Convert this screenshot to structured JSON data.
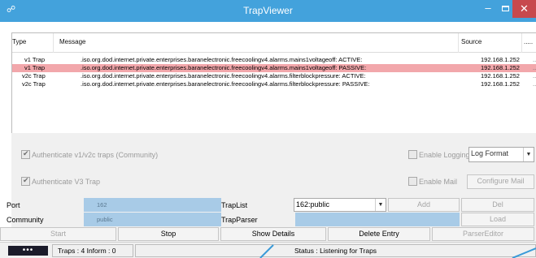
{
  "window": {
    "title": "TrapViewer"
  },
  "table": {
    "columns": [
      "Type",
      "Message",
      "Source",
      "....."
    ],
    "rows": [
      {
        "type": "v1 Trap",
        "message": ".iso.org.dod.internet.private.enterprises.baranelectronic.freecoolingv4.alarms.mains1voltageoff: ACTIVE:",
        "source": "192.168.1.252",
        "ext": "......",
        "selected": false
      },
      {
        "type": "v1 Trap",
        "message": ".iso.org.dod.internet.private.enterprises.baranelectronic.freecoolingv4.alarms.mains1voltageoff: PASSIVE:",
        "source": "192.168.1.252",
        "ext": "......",
        "selected": true
      },
      {
        "type": "v2c Trap",
        "message": ".iso.org.dod.internet.private.enterprises.baranelectronic.freecoolingv4.alarms.filterblockpressure: ACTIVE:",
        "source": "192.168.1.252",
        "ext": "......",
        "selected": false
      },
      {
        "type": "v2c Trap",
        "message": ".iso.org.dod.internet.private.enterprises.baranelectronic.freecoolingv4.alarms.filterblockpressure: PASSIVE:",
        "source": "192.168.1.252",
        "ext": "......",
        "selected": false
      }
    ]
  },
  "options": {
    "auth_v1v2c": "Authenticate v1/v2c traps (Community)",
    "auth_v1v2c_checked": true,
    "auth_v3": "Authenticate V3 Trap",
    "auth_v3_checked": true,
    "enable_logging": "Enable Logging",
    "enable_logging_checked": false,
    "log_format": "Log Format",
    "enable_mail": "Enable Mail",
    "enable_mail_checked": false,
    "configure_mail": "Configure Mail"
  },
  "form": {
    "port_label": "Port",
    "port_value": "162",
    "traplist_label": "TrapList",
    "traplist_value": "162:public",
    "add": "Add",
    "del": "Del",
    "community_label": "Community",
    "community_value": "public",
    "trapparser_label": "TrapParser",
    "trapparser_value": "",
    "load": "Load"
  },
  "actions": {
    "start": "Start",
    "stop": "Stop",
    "show_details": "Show Details",
    "delete_entry": "Delete Entry",
    "parser_editor": "ParserEditor"
  },
  "statusbar": {
    "dots": "•••",
    "counts": "Traps : 4 Inform : 0",
    "status": "Status : Listening for Traps"
  },
  "colors": {
    "titlebar": "#43a2dc",
    "close_button": "#c7494d",
    "selected_row": "#f2a7ab",
    "input_field": "#a8cbe7"
  },
  "icons": {
    "app": "satellite-dish-icon",
    "minimize": "minimize-icon",
    "maximize": "maximize-icon",
    "close": "close-icon",
    "dropdown": "chevron-down-icon",
    "checkbox": "checkmark-icon"
  }
}
